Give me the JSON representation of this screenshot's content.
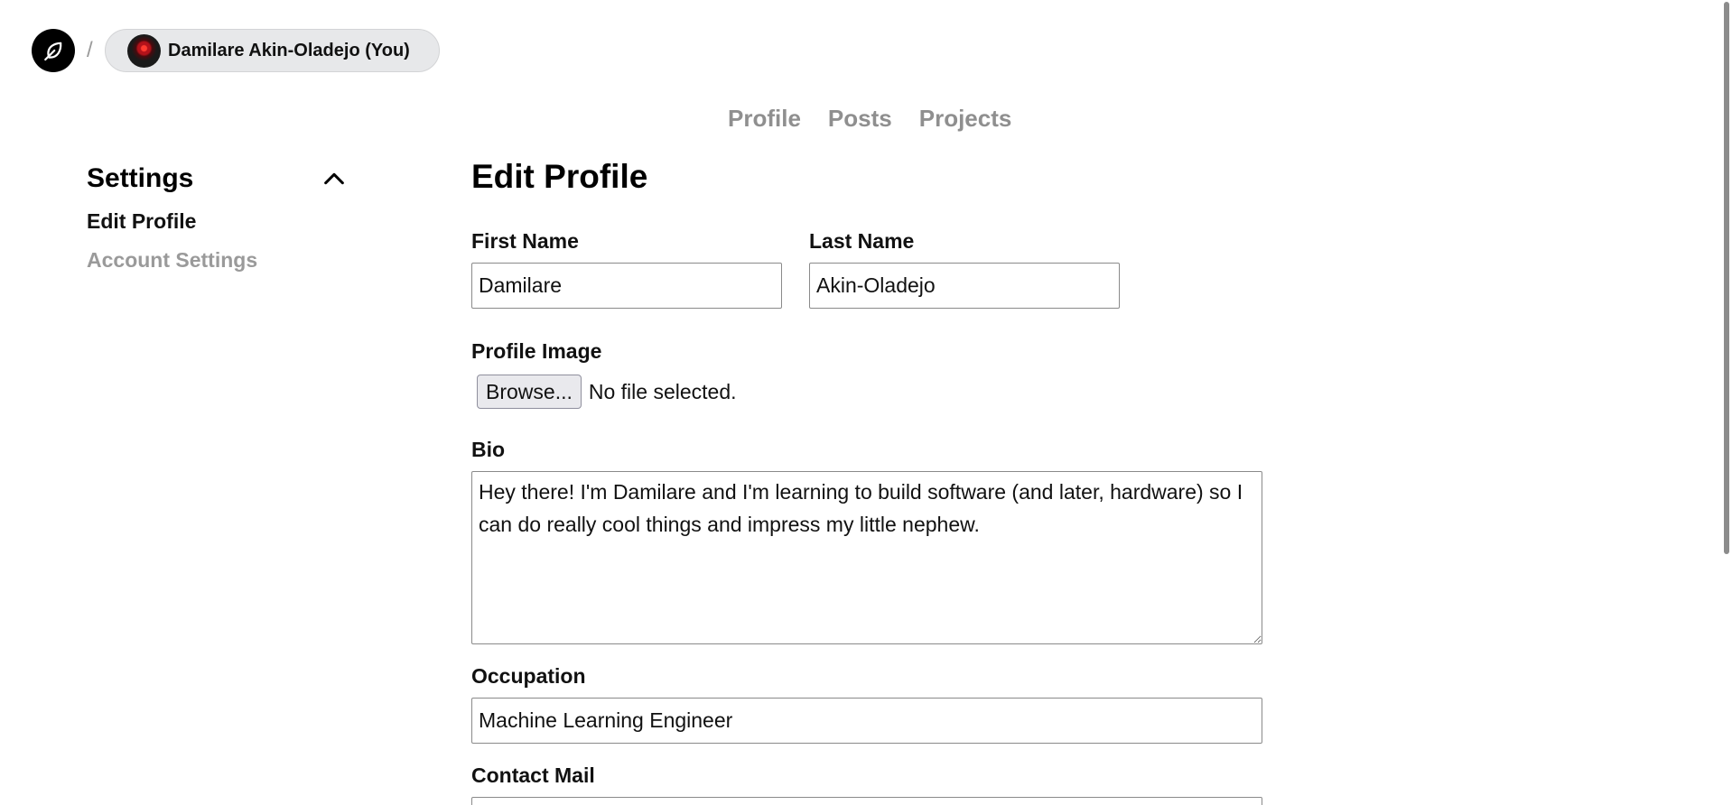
{
  "header": {
    "logo_icon": "leaf-icon",
    "separator": "/",
    "user_label": "Damilare Akin-Oladejo (You)"
  },
  "top_nav": {
    "items": [
      "Profile",
      "Posts",
      "Projects"
    ]
  },
  "sidebar": {
    "title": "Settings",
    "collapse_icon": "chevron-up-icon",
    "items": [
      {
        "label": "Edit Profile",
        "active": true
      },
      {
        "label": "Account Settings",
        "active": false
      }
    ]
  },
  "form": {
    "title": "Edit Profile",
    "first_name": {
      "label": "First Name",
      "value": "Damilare"
    },
    "last_name": {
      "label": "Last Name",
      "value": "Akin-Oladejo"
    },
    "profile_image": {
      "label": "Profile Image",
      "button": "Browse...",
      "status": "No file selected."
    },
    "bio": {
      "label": "Bio",
      "value": "Hey there! I'm Damilare and I'm learning to build software (and later, hardware) so I can do really cool things and impress my little nephew."
    },
    "occupation": {
      "label": "Occupation",
      "value": "Machine Learning Engineer"
    },
    "contact_mail": {
      "label": "Contact Mail",
      "value": ""
    }
  },
  "colors": {
    "muted_text": "#9a9a9a",
    "pill_bg": "#e7e8ea"
  }
}
